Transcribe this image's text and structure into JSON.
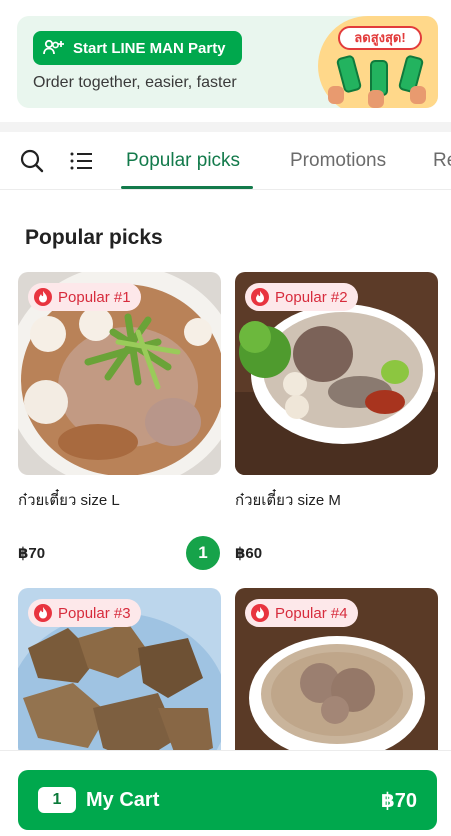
{
  "banner": {
    "party_label": "Start LINE MAN Party",
    "tagline": "Order together, easier, faster",
    "promo_text": "ลดสูงสุด!"
  },
  "tabs": {
    "items": [
      {
        "label": "Popular picks",
        "active": true
      },
      {
        "label": "Promotions",
        "active": false
      },
      {
        "label": "Re",
        "active": false
      }
    ]
  },
  "section": {
    "title": "Popular picks"
  },
  "items": [
    {
      "badge": "Popular #1",
      "name": "ก๋วยเตี๋ยว size L",
      "price": "฿70",
      "quantity": "1"
    },
    {
      "badge": "Popular #2",
      "name": "ก๋วยเตี๋ยว size M",
      "price": "฿60"
    },
    {
      "badge": "Popular #3"
    },
    {
      "badge": "Popular #4"
    }
  ],
  "cart": {
    "count": "1",
    "label": "My Cart",
    "total": "฿70"
  },
  "colors": {
    "accent": "#00a84d",
    "active_tab": "#137a4b",
    "badge_text": "#d72c3d",
    "badge_bg": "#fde8ea"
  }
}
